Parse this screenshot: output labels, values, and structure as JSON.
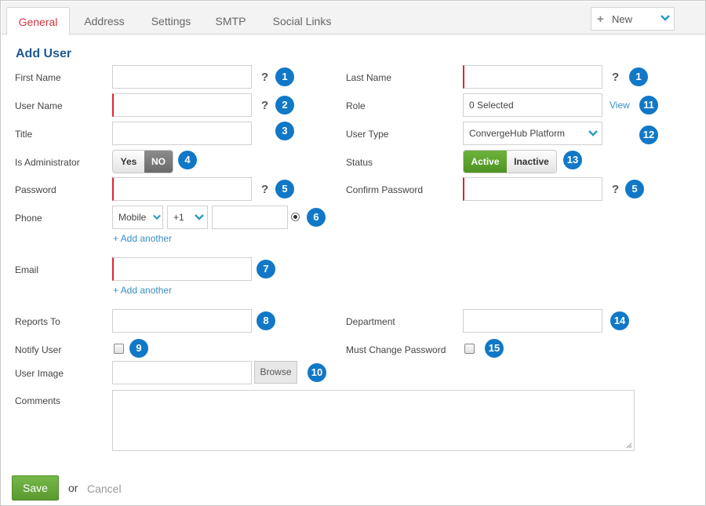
{
  "tabs": [
    "General",
    "Address",
    "Settings",
    "SMTP",
    "Social Links"
  ],
  "new_button": {
    "label": "New"
  },
  "form": {
    "heading": "Add User",
    "help": "?",
    "labels": {
      "first_name": "First Name",
      "last_name": "Last Name",
      "user_name": "User Name",
      "role": "Role",
      "title": "Title",
      "user_type": "User Type",
      "is_admin": "Is Administrator",
      "status": "Status",
      "password": "Password",
      "confirm_password": "Confirm Password",
      "phone": "Phone",
      "email": "Email",
      "reports_to": "Reports To",
      "department": "Department",
      "notify_user": "Notify User",
      "must_change_password": "Must Change Password",
      "user_image": "User Image",
      "comments": "Comments"
    },
    "role_value": "0 Selected",
    "role_view_link": "View",
    "user_type_value": "ConvergeHub Platform",
    "admin_toggle": {
      "yes": "Yes",
      "no": "NO",
      "selected": "NO"
    },
    "status_toggle": {
      "active": "Active",
      "inactive": "Inactive",
      "selected": "Active"
    },
    "phone": {
      "type": "Mobile",
      "country_code": "+1"
    },
    "add_another": "+ Add another",
    "browse": "Browse",
    "badges": [
      "1",
      "1",
      "2",
      "11",
      "3",
      "12",
      "4",
      "13",
      "5",
      "5",
      "6",
      "7",
      "8",
      "14",
      "9",
      "15",
      "10"
    ]
  },
  "footer": {
    "save": "Save",
    "or": "or",
    "cancel": "Cancel"
  },
  "colors": {
    "accent_blue": "#1178c7",
    "required_red": "#d9262f",
    "save_green": "#5a9a2f",
    "active_tab_red": "#d0353e"
  }
}
